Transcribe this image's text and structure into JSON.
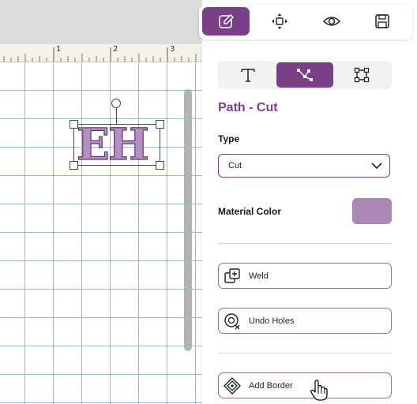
{
  "toolbar": {
    "items": [
      {
        "name": "edit",
        "icon": "pencil-square-icon",
        "active": true
      },
      {
        "name": "arrange",
        "icon": "move-arrows-icon",
        "active": false
      },
      {
        "name": "preview",
        "icon": "eye-icon",
        "active": false
      },
      {
        "name": "save",
        "icon": "floppy-disk-icon",
        "active": false
      }
    ]
  },
  "ruler": {
    "marks": [
      "1",
      "2",
      "3"
    ]
  },
  "canvas": {
    "design_text": "EH"
  },
  "panel": {
    "tabs": [
      {
        "name": "text",
        "icon": "text-tool-icon",
        "active": false
      },
      {
        "name": "path",
        "icon": "path-tool-icon",
        "active": true
      },
      {
        "name": "shape",
        "icon": "bounding-box-icon",
        "active": false
      }
    ],
    "title": "Path - Cut",
    "type_label": "Type",
    "type_value": "Cut",
    "material_color_label": "Material Color",
    "material_color": "#ab86b6",
    "weld_label": "Weld",
    "undo_holes_label": "Undo Holes",
    "add_border_label": "Add Border"
  },
  "colors": {
    "accent": "#7a3f86"
  }
}
